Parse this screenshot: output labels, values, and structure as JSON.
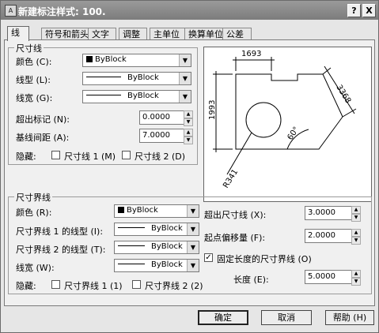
{
  "window": {
    "title": "新建标注样式: 100.",
    "help_label": "?",
    "close_label": "X",
    "app_icon_text": "A"
  },
  "tabs": [
    {
      "label": "线",
      "active": true
    },
    {
      "label": "符号和箭头",
      "active": false
    },
    {
      "label": "文字",
      "active": false
    },
    {
      "label": "调整",
      "active": false
    },
    {
      "label": "主单位",
      "active": false
    },
    {
      "label": "换算单位",
      "active": false
    },
    {
      "label": "公差",
      "active": false
    }
  ],
  "dim_line": {
    "group_title": "尺寸线",
    "color_label": "颜色 (C):",
    "color_value": "ByBlock",
    "linetype_label": "线型 (L):",
    "linetype_value": "ByBlock",
    "lineweight_label": "线宽 (G):",
    "lineweight_value": "ByBlock",
    "extend_ticks_label": "超出标记 (N):",
    "extend_ticks_value": "0.0000",
    "baseline_spacing_label": "基线间距 (A):",
    "baseline_spacing_value": "7.0000",
    "suppress_label": "隐藏:",
    "suppress_1_label": "尺寸线 1 (M)",
    "suppress_1_checked": false,
    "suppress_2_label": "尺寸线 2 (D)",
    "suppress_2_checked": false
  },
  "ext_line": {
    "group_title": "尺寸界线",
    "color_label": "颜色 (R):",
    "color_value": "ByBlock",
    "linetype1_label": "尺寸界线 1 的线型 (I):",
    "linetype1_value": "ByBlock",
    "linetype2_label": "尺寸界线 2 的线型 (T):",
    "linetype2_value": "ByBlock",
    "lineweight_label": "线宽 (W):",
    "lineweight_value": "ByBlock",
    "suppress_label": "隐藏:",
    "suppress_1_label": "尺寸界线 1 (1)",
    "suppress_1_checked": false,
    "suppress_2_label": "尺寸界线 2 (2)",
    "suppress_2_checked": false,
    "extend_label": "超出尺寸线 (X):",
    "extend_value": "3.0000",
    "offset_label": "起点偏移量 (F):",
    "offset_value": "2.0000",
    "fixed_length_label": "固定长度的尺寸界线 (O)",
    "fixed_length_checked": true,
    "length_label": "长度 (E):",
    "length_value": "5.0000"
  },
  "preview": {
    "dim_top": "1693",
    "dim_left": "1993",
    "dim_right": "3368",
    "dim_angle": "60°",
    "dim_radius": "R341"
  },
  "buttons": {
    "ok": "确定",
    "cancel": "取消",
    "help": "帮助 (H)"
  }
}
